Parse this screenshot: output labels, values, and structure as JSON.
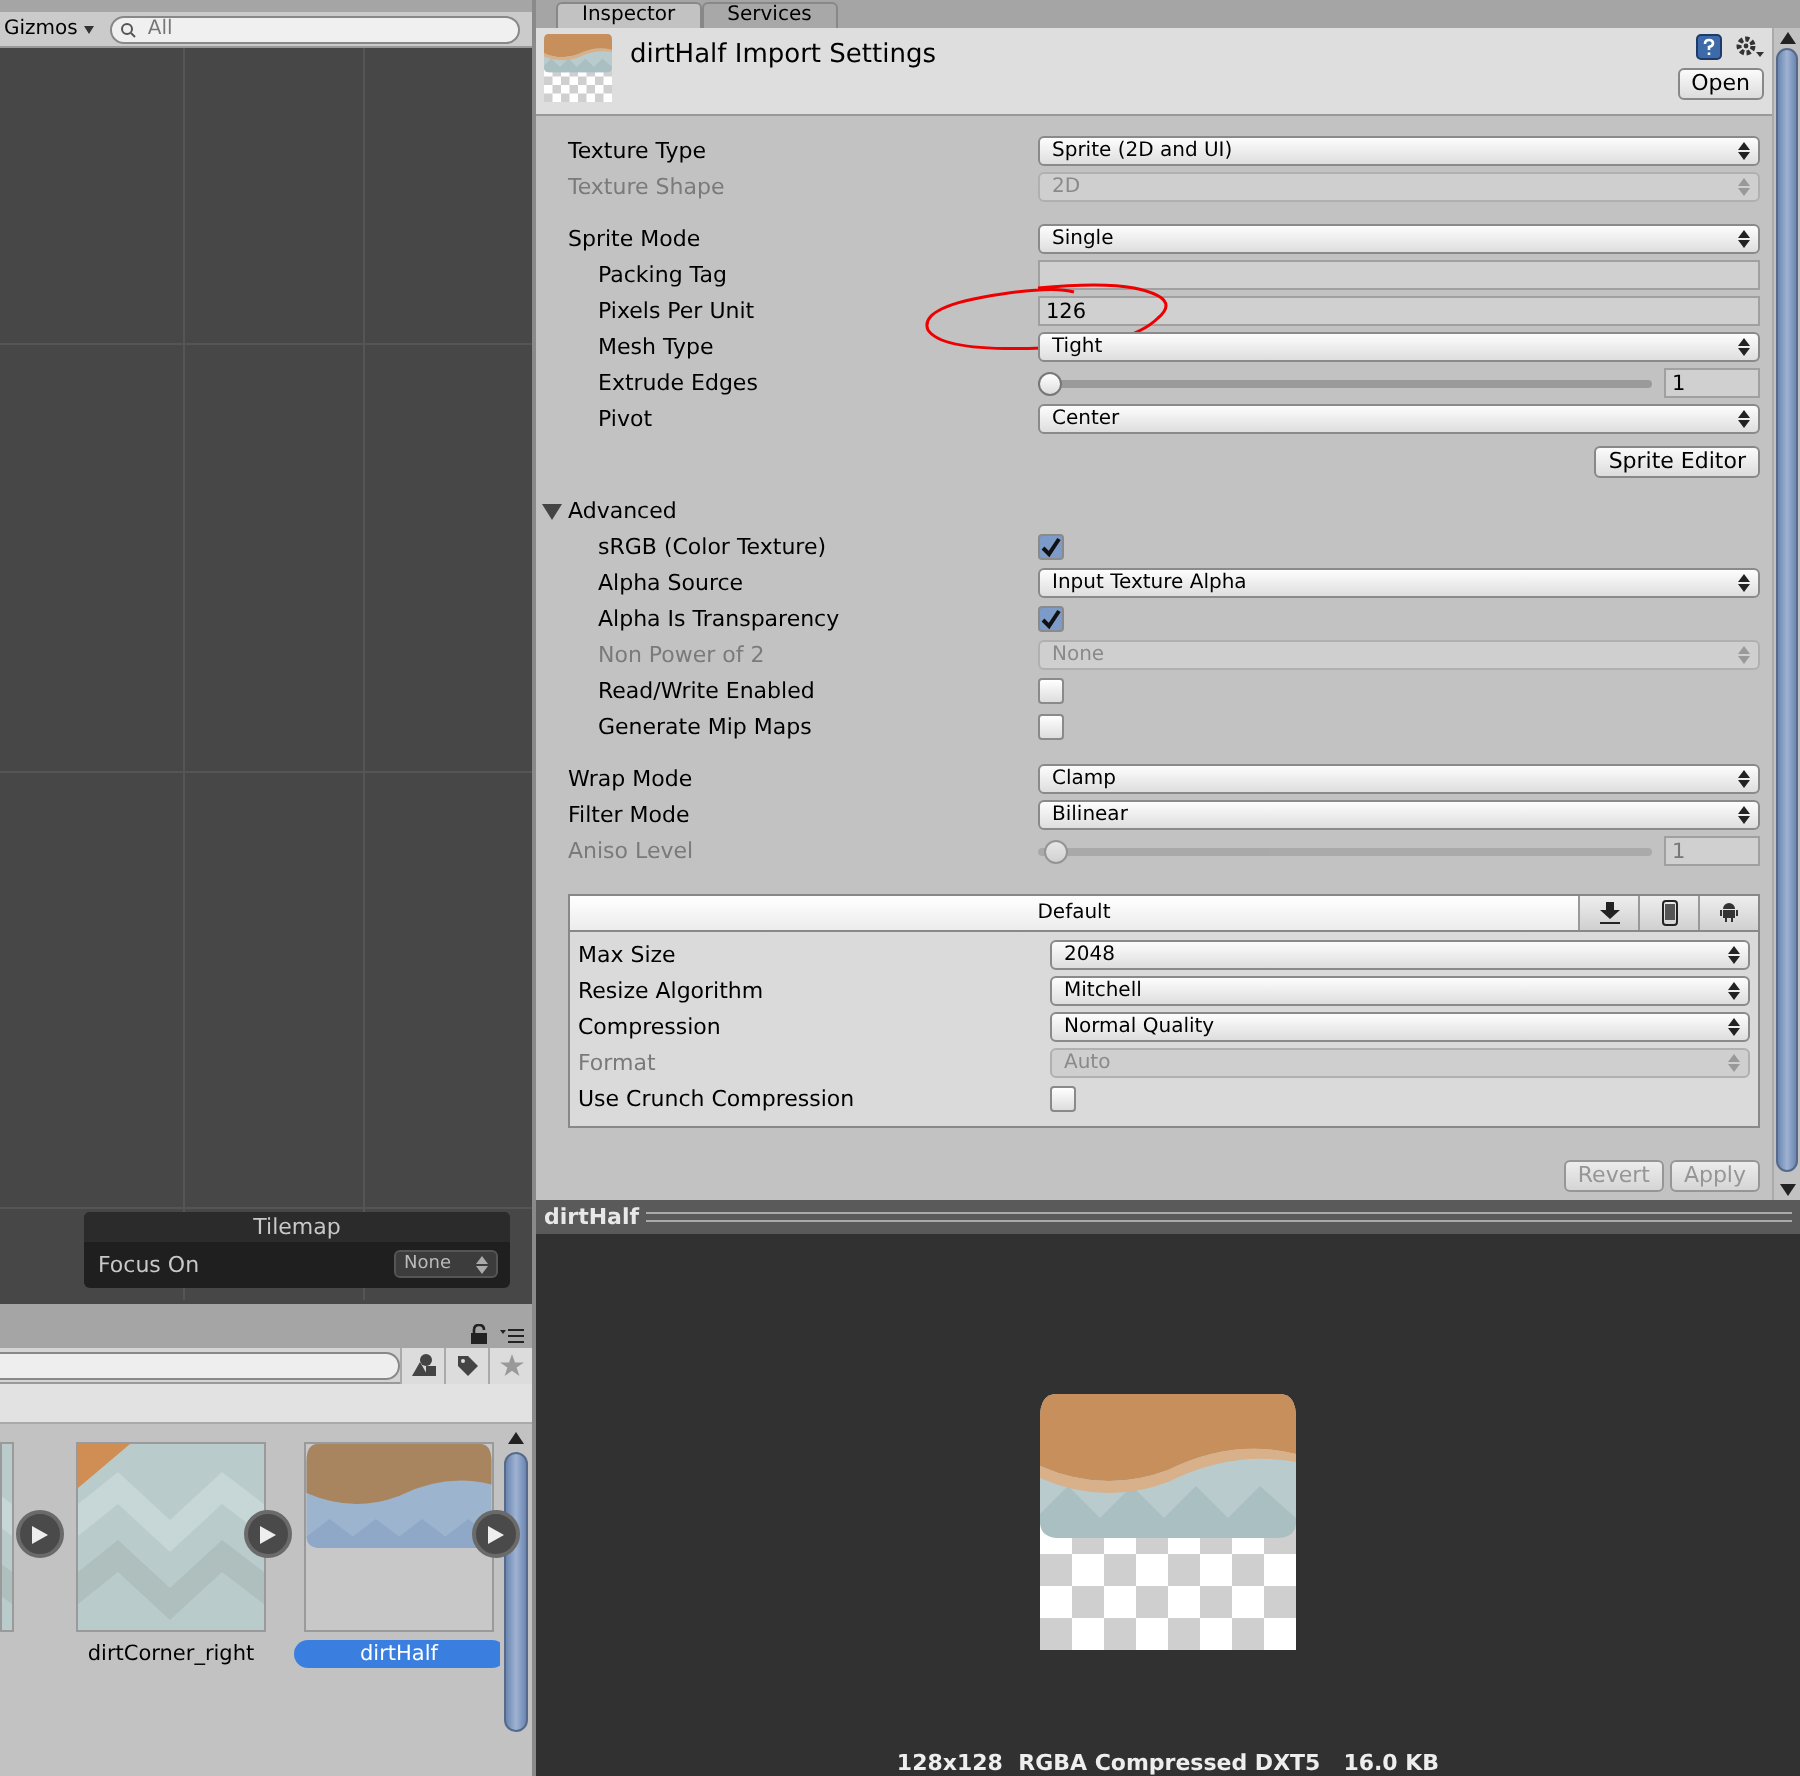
{
  "scene": {
    "gizmos": "Gizmos",
    "search": {
      "placeholder": "All"
    },
    "overlay": {
      "title": "Tilemap",
      "label": "Focus On",
      "value": "None"
    }
  },
  "inspector": {
    "tabs": [
      {
        "label": "Inspector",
        "selected": true
      },
      {
        "label": "Services",
        "selected": false
      }
    ],
    "title": "dirtHalf Import Settings",
    "open_button": "Open",
    "groups": [
      {
        "rows": [
          {
            "kind": "dropdown",
            "label": "Texture Type",
            "value": "Sprite (2D and UI)",
            "disabled": false
          },
          {
            "kind": "dropdown",
            "label": "Texture Shape",
            "value": "2D",
            "disabled": true
          }
        ]
      },
      {
        "rows": [
          {
            "kind": "dropdown",
            "label": "Sprite Mode",
            "value": "Single",
            "disabled": false,
            "children": [
              {
                "kind": "text",
                "label": "Packing Tag"
              },
              {
                "kind": "text",
                "label": "Pixels Per Unit",
                "value": "126",
                "circled": true
              },
              {
                "kind": "dropdown",
                "label": "Mesh Type",
                "value": "Tight",
                "disabled": false
              },
              {
                "kind": "slider",
                "label": "Extrude Edges",
                "level": 0.02,
                "value": "1",
                "disabled": false
              },
              {
                "kind": "dropdown",
                "label": "Pivot",
                "value": "Center",
                "disabled": false
              }
            ]
          }
        ],
        "button": "Sprite Editor"
      },
      {
        "foldout": {
          "label": "Advanced",
          "expanded": true
        },
        "rows": [
          {
            "kind": "checkbox",
            "label": "sRGB (Color Texture)",
            "checked": true
          },
          {
            "kind": "dropdown",
            "label": "Alpha Source",
            "value": "Input Texture Alpha",
            "disabled": false
          },
          {
            "kind": "checkbox",
            "label": "Alpha Is Transparency",
            "checked": true
          },
          {
            "kind": "dropdown",
            "label": "Non Power of 2",
            "value": "None",
            "disabled": true
          },
          {
            "kind": "checkbox",
            "label": "Read/Write Enabled",
            "checked": false
          },
          {
            "kind": "checkbox",
            "label": "Generate Mip Maps",
            "checked": false
          }
        ]
      },
      {
        "rows": [
          {
            "kind": "dropdown",
            "label": "Wrap Mode",
            "value": "Clamp",
            "disabled": false
          },
          {
            "kind": "dropdown",
            "label": "Filter Mode",
            "value": "Bilinear",
            "disabled": false
          },
          {
            "kind": "slider",
            "label": "Aniso Level",
            "level": 0.03,
            "value": "1",
            "disabled": true
          }
        ]
      }
    ],
    "platform": {
      "tab": "Default",
      "rows": [
        {
          "kind": "dropdown",
          "label": "Max Size",
          "value": "2048",
          "disabled": false
        },
        {
          "kind": "dropdown",
          "label": "Resize Algorithm",
          "value": "Mitchell",
          "disabled": false
        },
        {
          "kind": "dropdown",
          "label": "Compression",
          "value": "Normal Quality",
          "disabled": false
        },
        {
          "kind": "dropdown",
          "label": "Format",
          "value": "Auto",
          "disabled": true
        },
        {
          "kind": "checkbox",
          "label": "Use Crunch Compression",
          "checked": false
        }
      ]
    },
    "buttons": [
      {
        "label": "Revert",
        "disabled": true
      },
      {
        "label": "Apply",
        "disabled": true
      }
    ]
  },
  "preview": {
    "title": "dirtHalf",
    "info": "128x128  RGBA Compressed DXT5   16.0 KB"
  },
  "project": {
    "assets": [
      {
        "name": "dirtCorner_right",
        "kind": "corner",
        "selected": false
      },
      {
        "name": "dirtHalf",
        "kind": "half",
        "selected": true
      }
    ]
  }
}
